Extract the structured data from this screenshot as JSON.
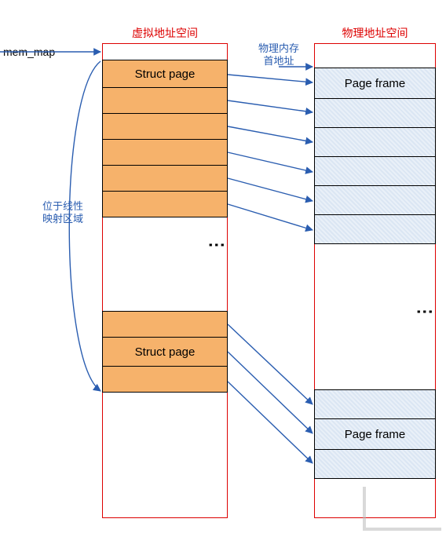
{
  "pointer_label": "mem_map",
  "left": {
    "title": "虚拟地址空间",
    "top_struct": "Struct page",
    "bottom_struct": "Struct page"
  },
  "right": {
    "title": "物理地址空间",
    "top_frame": "Page frame",
    "bottom_frame": "Page frame"
  },
  "annotations": {
    "linear_region": "位于线性\n映射区域",
    "phys_start": "物理内存\n首地址"
  }
}
